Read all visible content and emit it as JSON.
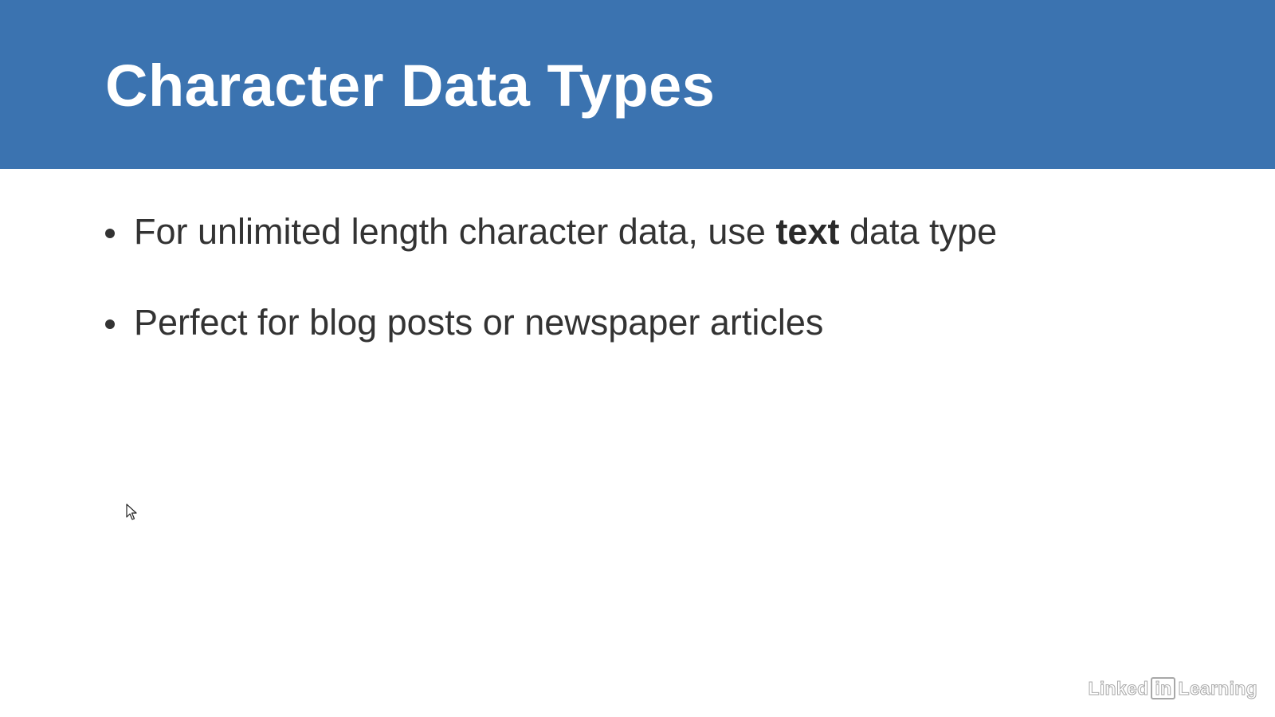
{
  "slide": {
    "title": "Character Data Types",
    "bullets": [
      {
        "before": "For unlimited length character data, use ",
        "bold": "text",
        "after": " data type"
      },
      {
        "text": "Perfect for blog posts or newspaper articles"
      }
    ]
  },
  "watermark": {
    "part1": "Linked",
    "part2": "in",
    "part3": "Learning"
  },
  "colors": {
    "header_background": "#3b73b0",
    "title_text": "#ffffff",
    "body_text": "#333333"
  },
  "icons": {
    "cursor": "mouse-pointer-icon"
  }
}
